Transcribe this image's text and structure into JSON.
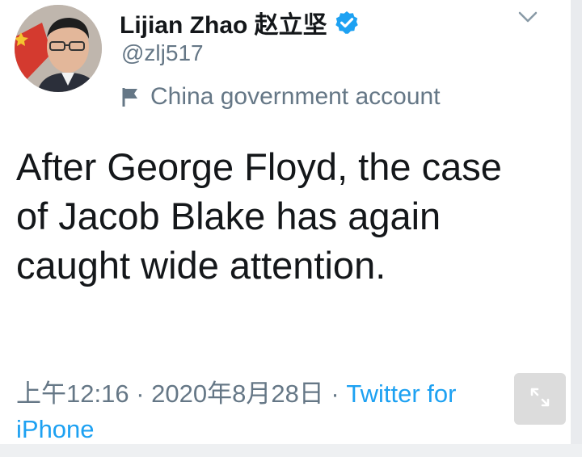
{
  "tweet": {
    "author": {
      "display_name": "Lijian Zhao 赵立坚",
      "handle": "@zlj517",
      "verified": true
    },
    "account_label": "China government account",
    "text": "After George Floyd, the case of Jacob Blake has again caught wide attention.",
    "timestamp": "上午12:16 · 2020年8月28日",
    "separator": " · ",
    "source": "Twitter for iPhone"
  },
  "icons": {
    "verified": "verified-badge-icon",
    "label": "flag-icon",
    "menu": "chevron-down-icon",
    "expand": "expand-icon"
  },
  "colors": {
    "verified_blue": "#1da1f2",
    "link_blue": "#1da1f2",
    "secondary_text": "#657786",
    "primary_text": "#14171a"
  }
}
